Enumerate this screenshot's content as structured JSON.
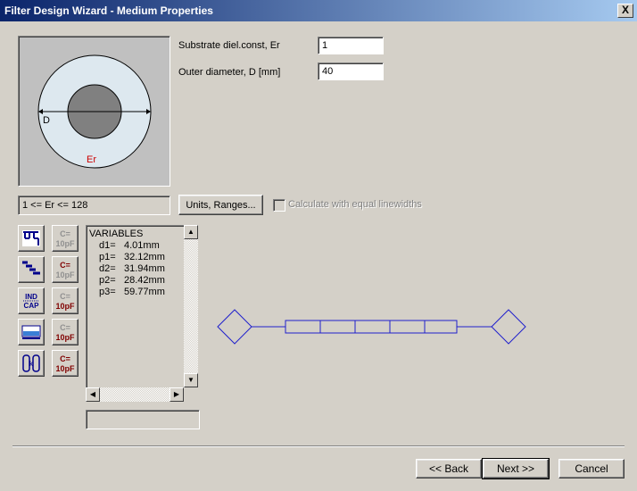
{
  "window": {
    "title": "Filter Design Wizard - Medium Properties",
    "close_glyph": "X"
  },
  "diagram": {
    "d_label": "D",
    "er_label": "Er"
  },
  "fields": {
    "er": {
      "label": "Substrate diel.const, Er",
      "value": "1"
    },
    "d": {
      "label": "Outer diameter, D [mm]",
      "value": "40"
    }
  },
  "range_text": "1 <= Er <= 128",
  "units_button": "Units, Ranges...",
  "checkbox_label": "Calculate with equal linewidths",
  "variables": {
    "header": "VARIABLES",
    "rows": [
      {
        "name": "d1=",
        "value": "4.01mm"
      },
      {
        "name": "p1=",
        "value": "32.12mm"
      },
      {
        "name": "d2=",
        "value": "31.94mm"
      },
      {
        "name": "p2=",
        "value": "28.42mm"
      },
      {
        "name": "p3=",
        "value": "59.77mm"
      }
    ]
  },
  "cap_label": {
    "line1": "C=",
    "line2": "10pF"
  },
  "ind_label": {
    "line1": "IND",
    "line2": "CAP"
  },
  "scroll": {
    "up": "▲",
    "down": "▼",
    "left": "◀",
    "right": "▶"
  },
  "buttons": {
    "back": "<< Back",
    "next": "Next >>",
    "cancel": "Cancel"
  },
  "colors": {
    "title_start": "#0a246a",
    "title_end": "#a6caf0",
    "circuit": "#1f1fcc",
    "er_label": "#cc0000",
    "cap_dark": "#800000"
  }
}
